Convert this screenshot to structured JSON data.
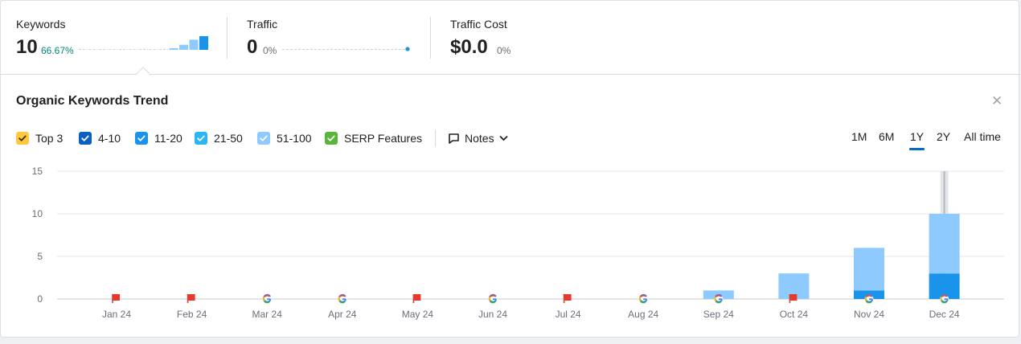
{
  "metrics": [
    {
      "label": "Keywords",
      "value": "10",
      "pct": "66.67%",
      "pct_color": "#00857c"
    },
    {
      "label": "Traffic",
      "value": "0",
      "pct": "0%",
      "pct_color": "#6c6e79"
    },
    {
      "label": "Traffic Cost",
      "value": "$0.0",
      "pct": "0%",
      "pct_color": "#6c6e79"
    }
  ],
  "keywords_sparkline": [
    0,
    0,
    0,
    0,
    0,
    0,
    0,
    0,
    0,
    1,
    3,
    6,
    10
  ],
  "traffic_sparkline": [
    0,
    0,
    0,
    0,
    0,
    0,
    0,
    0,
    0,
    0,
    0,
    0,
    0
  ],
  "panel": {
    "title": "Organic Keywords Trend",
    "close_icon": "close-icon"
  },
  "filters": [
    {
      "label": "Top 3",
      "color": "#ffc83d",
      "checked": true
    },
    {
      "label": "4-10",
      "color": "#0a60c2",
      "checked": true
    },
    {
      "label": "11-20",
      "color": "#1a94eb",
      "checked": true
    },
    {
      "label": "21-50",
      "color": "#2bb7f6",
      "checked": true
    },
    {
      "label": "51-100",
      "color": "#8ecafe",
      "checked": true
    },
    {
      "label": "SERP Features",
      "color": "#59b63a",
      "checked": true
    }
  ],
  "notes": {
    "label": "Notes",
    "icon": "comment-icon"
  },
  "ranges": [
    {
      "label": "1M",
      "active": false
    },
    {
      "label": "6M",
      "active": false
    },
    {
      "label": "1Y",
      "active": true
    },
    {
      "label": "2Y",
      "active": false
    },
    {
      "label": "All time",
      "active": false
    }
  ],
  "chart_data": {
    "type": "bar",
    "stacked": true,
    "categories": [
      "Jan 24",
      "Feb 24",
      "Mar 24",
      "Apr 24",
      "May 24",
      "Jun 24",
      "Jul 24",
      "Aug 24",
      "Sep 24",
      "Oct 24",
      "Nov 24",
      "Dec 24"
    ],
    "yticks": [
      0,
      5,
      10,
      15
    ],
    "ylim": [
      0,
      15
    ],
    "series": [
      {
        "name": "11-20",
        "color": "#1a94eb",
        "values": [
          0,
          0,
          0,
          0,
          0,
          0,
          0,
          0,
          0,
          0,
          1,
          3
        ]
      },
      {
        "name": "51-100",
        "color": "#8ecafe",
        "values": [
          0,
          0,
          0,
          0,
          0,
          0,
          0,
          0,
          1,
          3,
          5,
          7
        ]
      }
    ],
    "markers": [
      "flag",
      "flag",
      "google",
      "google",
      "flag",
      "google",
      "flag",
      "google",
      "google",
      "flag",
      "google",
      "google"
    ],
    "highlighted_category": "Dec 24",
    "grid": true
  }
}
